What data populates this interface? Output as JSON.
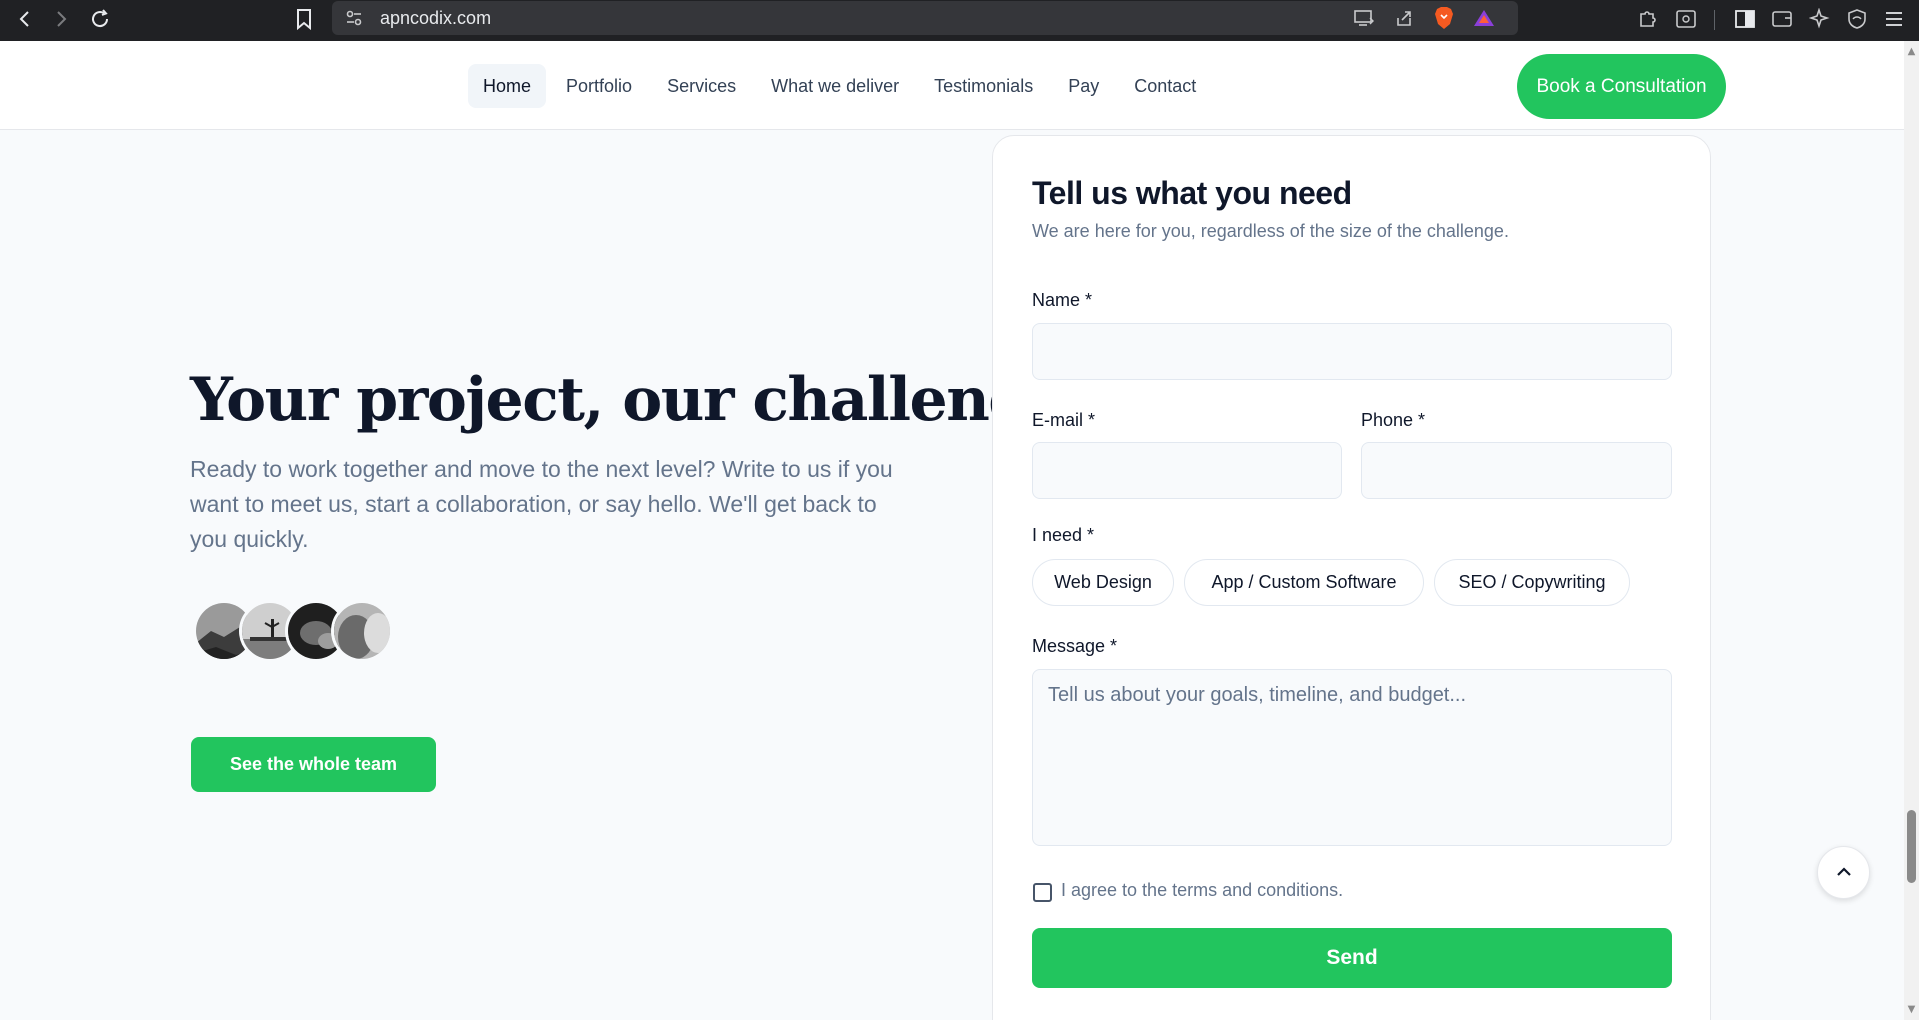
{
  "browser": {
    "url": "apncodix.com",
    "icons": [
      "back-icon",
      "forward-icon",
      "reload-icon",
      "bookmark-icon",
      "site-settings-icon",
      "install-app-icon",
      "share-icon",
      "brave-shields-icon",
      "brave-rewards-icon",
      "extensions-icon",
      "reader-mode-icon",
      "sidebar-icon",
      "wallet-icon",
      "leo-ai-icon",
      "vpn-icon",
      "menu-icon"
    ]
  },
  "header": {
    "nav": [
      "Home",
      "Portfolio",
      "Services",
      "What we deliver",
      "Testimonials",
      "Pay",
      "Contact"
    ],
    "active": "Home",
    "cta_label": "Book a Consultation"
  },
  "hero": {
    "title": "Your project, our challenge!",
    "text": "Ready to work together and move to the next level? Write to us if you want to meet us, start a collaboration, or say hello. We'll get back to you quickly.",
    "team_button": "See the whole team"
  },
  "form": {
    "title": "Tell us what you need",
    "subtitle": "We are here for you, regardless of the size of the challenge.",
    "name_label": "Name *",
    "email_label": "E-mail *",
    "phone_label": "Phone *",
    "need_label": "I need *",
    "need_options": [
      "Web Design",
      "App / Custom Software",
      "SEO / Copywriting"
    ],
    "message_label": "Message *",
    "message_placeholder": "Tell us about your goals, timeline, and budget...",
    "agree_label": "I agree to the terms and conditions.",
    "send_label": "Send"
  },
  "colors": {
    "accent": "#22c55e",
    "text": "#0f172a",
    "muted": "#64748b"
  }
}
